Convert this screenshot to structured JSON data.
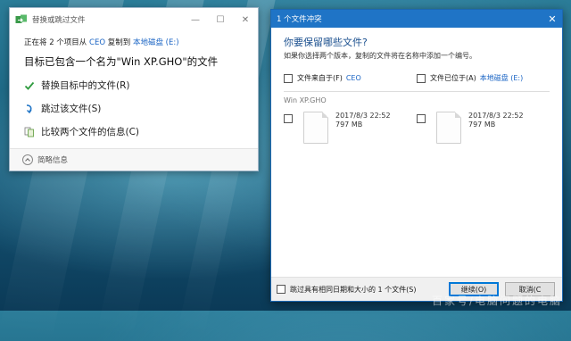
{
  "replace_dialog": {
    "title": "替换或跳过文件",
    "info": {
      "prefix": "正在将 2 个项目从",
      "source": "CEO",
      "middle": "复制到",
      "dest": "本地磁盘 (E:)"
    },
    "headline": "目标已包含一个名为\"Win XP.GHO\"的文件",
    "options": [
      {
        "label": "替换目标中的文件(R)",
        "icon": "checkmark-icon"
      },
      {
        "label": "跳过该文件(S)",
        "icon": "skip-arrow-icon"
      },
      {
        "label": "比较两个文件的信息(C)",
        "icon": "compare-docs-icon"
      }
    ],
    "details_label": "简略信息"
  },
  "conflict_dialog": {
    "title": "1 个文件冲突",
    "question": "你要保留哪些文件?",
    "subtitle": "如果你选择两个版本，复制的文件将在名称中添加一个编号。",
    "col_from": {
      "text": "文件来自于(F)",
      "link": "CEO"
    },
    "col_in": {
      "text": "文件已位于(A)",
      "link": "本地磁盘 (E:)"
    },
    "file_name": "Win XP.GHO",
    "source_file": {
      "date": "2017/8/3 22:52",
      "size": "797 MB"
    },
    "dest_file": {
      "date": "2017/8/3 22:52",
      "size": "797 MB"
    },
    "skip_same_label": "跳过具有相同日期和大小的 1 个文件(S)",
    "continue_label": "继续(O)",
    "cancel_label": "取消(C"
  },
  "watermark": "百家号/电脑问题的电脑",
  "colors": {
    "accent": "#1f74c6",
    "link": "#1a64c4",
    "check_green": "#2e9b3e"
  }
}
